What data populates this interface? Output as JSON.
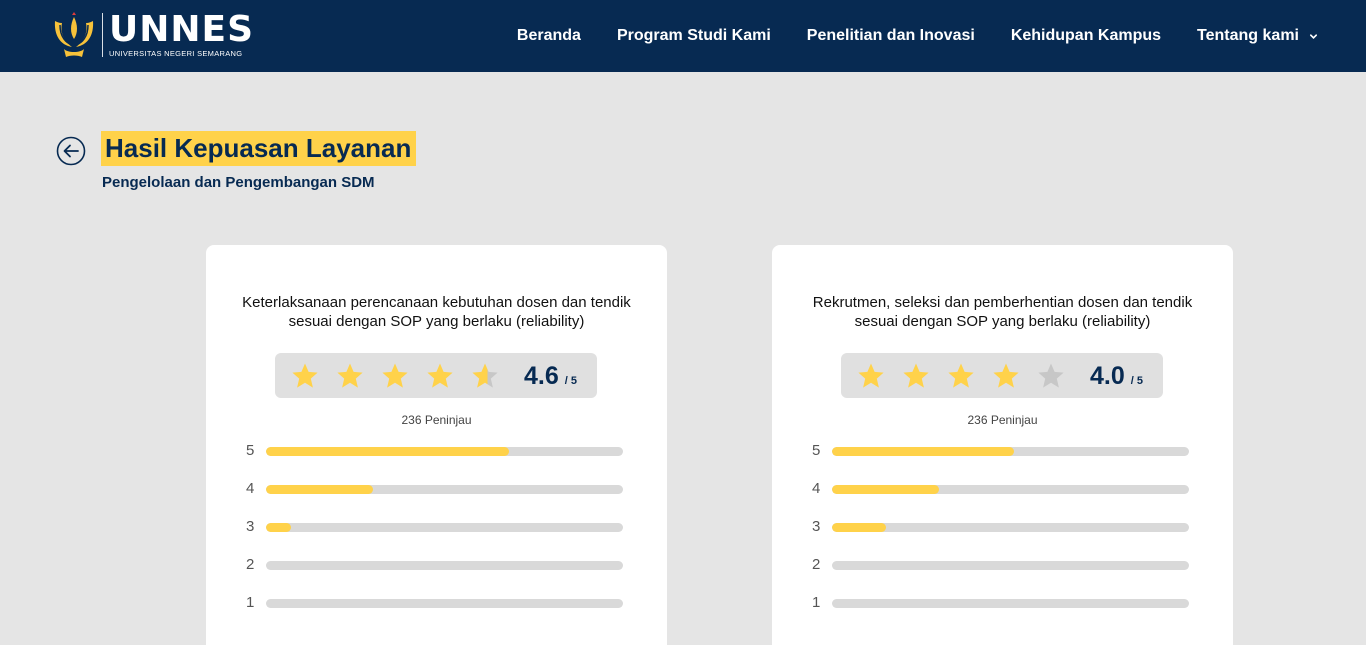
{
  "header": {
    "logo": {
      "name": "UNNES",
      "subtitle": "UNIVERSITAS NEGERI SEMARANG"
    },
    "nav": [
      {
        "label": "Beranda"
      },
      {
        "label": "Program Studi Kami"
      },
      {
        "label": "Penelitian dan Inovasi"
      },
      {
        "label": "Kehidupan Kampus"
      },
      {
        "label": "Tentang kami",
        "has_dropdown": true
      }
    ]
  },
  "page": {
    "back_icon": "arrow-left-circle-icon",
    "title": "Hasil Kepuasan Layanan",
    "subtitle": "Pengelolaan dan Pengembangan SDM"
  },
  "colors": {
    "header_bg": "#072a52",
    "accent_yellow": "#ffd24a",
    "page_bg": "#e5e5e5",
    "star_empty": "#c7c7c7"
  },
  "cards": [
    {
      "question": "Keterlaksanaan perencanaan kebutuhan dosen dan tendik sesuai dengan SOP yang berlaku (reliability)",
      "score": "4.6",
      "score_max": "/ 5",
      "rating": 4.6,
      "reviews": "236 Peninjau",
      "distribution": [
        {
          "label": "5",
          "fraction": 0.68
        },
        {
          "label": "4",
          "fraction": 0.3
        },
        {
          "label": "3",
          "fraction": 0.07
        },
        {
          "label": "2",
          "fraction": 0.0
        },
        {
          "label": "1",
          "fraction": 0.0
        }
      ]
    },
    {
      "question": "Rekrutmen, seleksi dan pemberhentian dosen dan tendik sesuai dengan SOP yang berlaku (reliability)",
      "score": "4.0",
      "score_max": "/ 5",
      "rating": 4.0,
      "reviews": "236 Peninjau",
      "distribution": [
        {
          "label": "5",
          "fraction": 0.51
        },
        {
          "label": "4",
          "fraction": 0.3
        },
        {
          "label": "3",
          "fraction": 0.15
        },
        {
          "label": "2",
          "fraction": 0.0
        },
        {
          "label": "1",
          "fraction": 0.0
        }
      ]
    }
  ]
}
